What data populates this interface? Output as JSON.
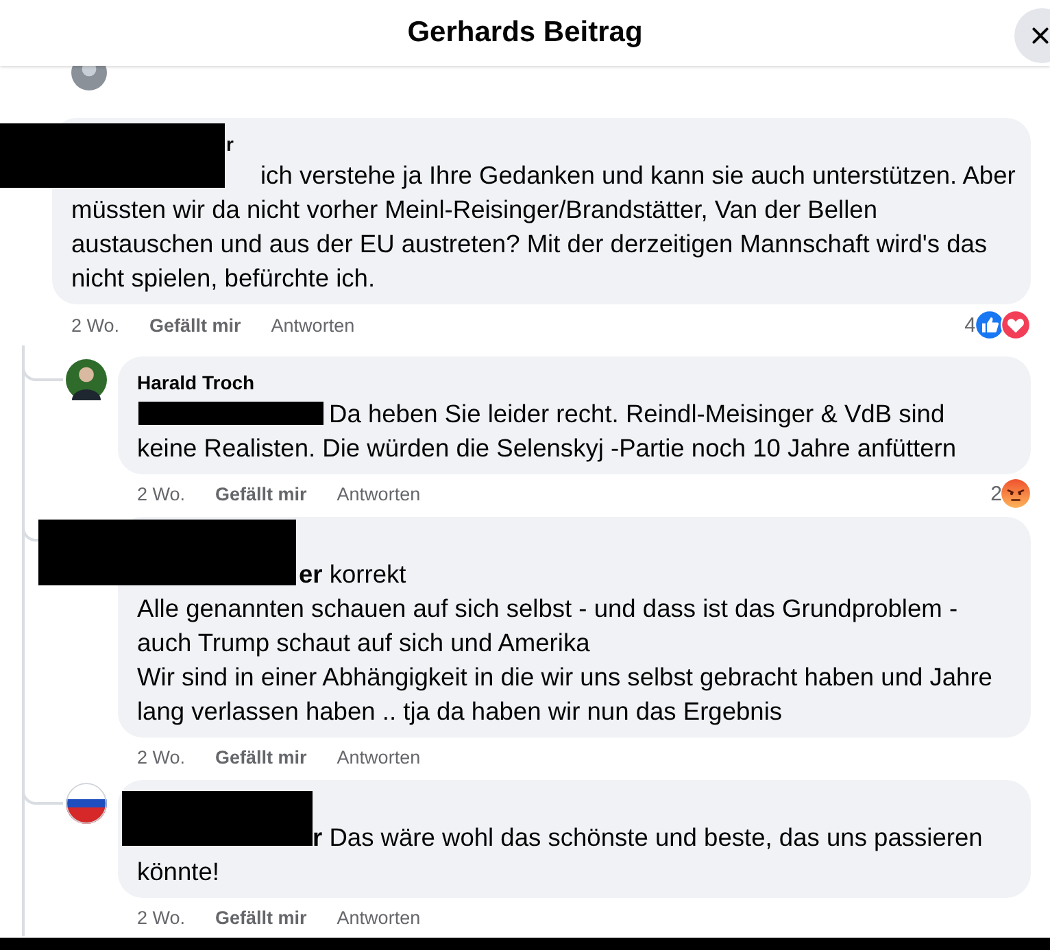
{
  "dialog": {
    "title": "Gerhards Beitrag"
  },
  "comments": [
    {
      "kind": "comment",
      "redacted": true,
      "author": "r",
      "mention_hidden": true,
      "text": "ich verstehe ja Ihre Gedanken und kann sie auch unterstützen. Aber müssten wir da nicht vorher Meinl-Reisinger/Brandstätter, Van der Bellen austauschen und aus der EU austreten? Mit der derzeitigen Mannschaft wird's das nicht spielen, befürchte ich.",
      "time": "2 Wo.",
      "like_label": "Gefällt mir",
      "reply_label": "Antworten",
      "reactions": {
        "count": "4",
        "types": [
          {
            "kind": "like"
          },
          {
            "kind": "love"
          }
        ]
      }
    },
    {
      "kind": "reply",
      "redacted": true,
      "author": "Harald Troch",
      "mention_hidden": true,
      "text": "Da heben Sie leider recht. Reindl-Meisinger & VdB sind keine Realisten. Die würden die Selenskyj -Partie noch 10 Jahre anfüttern",
      "time": "2 Wo.",
      "like_label": "Gefällt mir",
      "reply_label": "Antworten",
      "reactions": {
        "count": "2",
        "types": [
          {
            "kind": "angry"
          }
        ]
      }
    },
    {
      "kind": "reply",
      "redacted": true,
      "mention_hidden": true,
      "text": "**er** korrekt\nAlle genannten schauen auf sich selbst - und dass ist das Grundproblem - auch Trump schaut auf sich und Amerika\nWir sind in einer Abhängigkeit in die wir uns selbst gebracht haben und Jahre lang verlassen haben .. tja da haben wir nun das Ergebnis",
      "time": "2 Wo.",
      "like_label": "Gefällt mir",
      "reply_label": "Antworten"
    },
    {
      "kind": "reply",
      "redacted": true,
      "mention_hidden": true,
      "text": "**r** Das wäre wohl das schönste und beste, das uns passieren könnte!",
      "time": "2 Wo.",
      "like_label": "Gefällt mir",
      "reply_label": "Antworten"
    }
  ]
}
